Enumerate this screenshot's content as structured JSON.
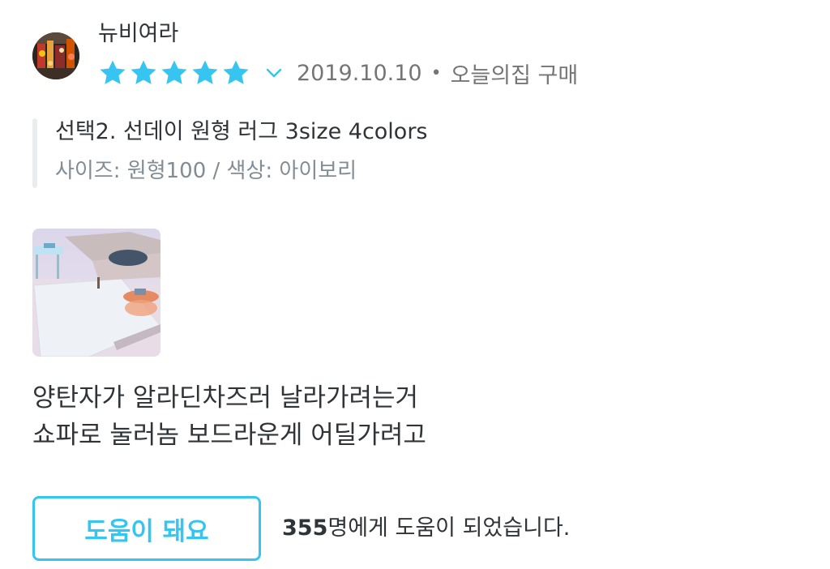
{
  "review": {
    "author": "뉴비여라",
    "rating": 5,
    "rating_max": 5,
    "date": "2019.10.10",
    "separator": "•",
    "source": "오늘의집 구매",
    "option": {
      "product": "선택2. 선데이 원형 러그 3size 4colors",
      "detail": "사이즈: 원형100 / 색상: 아이보리"
    },
    "body_lines": [
      "양탄자가 알라딘차즈러 날라가려는거",
      "쇼파로 눌러놈 보드라운게 어딜가려고"
    ],
    "helpful": {
      "button_label": "도움이 돼요",
      "count": "355",
      "suffix": "명에게 도움이 되었습니다."
    }
  },
  "icons": {
    "star": "star-icon",
    "chevron": "chevron-down-icon"
  },
  "colors": {
    "accent": "#35c5f0",
    "text": "#2f3438",
    "muted": "#757575",
    "option_bar": "#eaedef"
  }
}
